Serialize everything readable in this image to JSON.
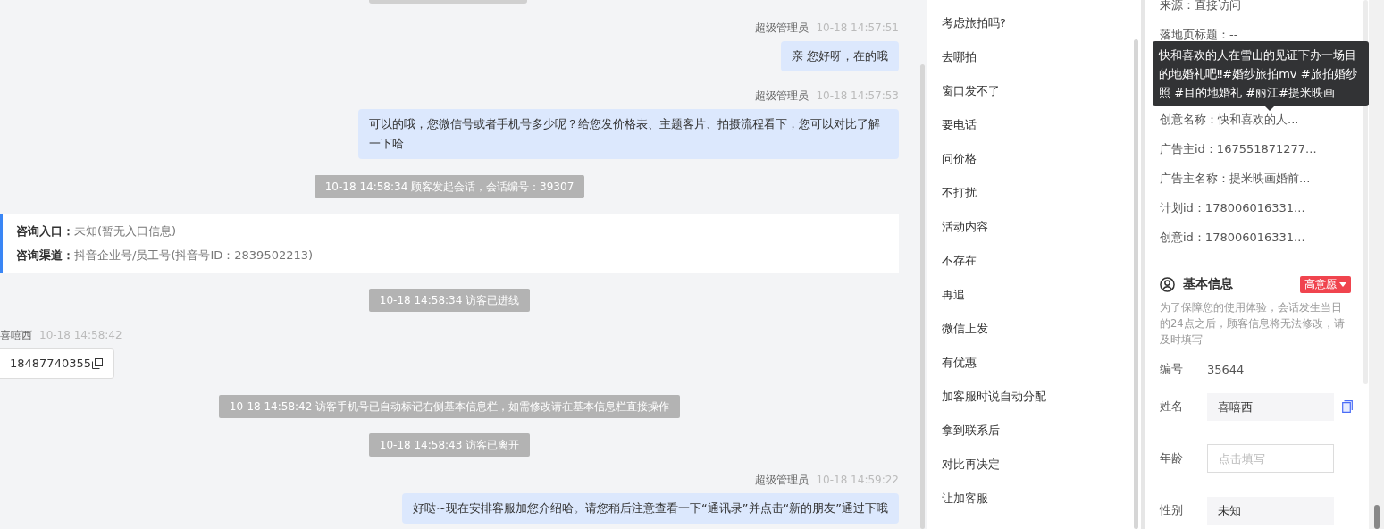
{
  "chat": {
    "messages": [
      {
        "kind": "agent",
        "sender": "超级管理员",
        "time": "10-18 14:57:51",
        "text": "亲 您好呀，在的哦"
      },
      {
        "kind": "agent",
        "sender": "超级管理员",
        "time": "10-18 14:57:53",
        "text": "可以的哦，您微信号或者手机号多少呢？给您发价格表、主题客片、拍摄流程看下，您可以对比了解一下哈"
      },
      {
        "kind": "system",
        "text": "10-18 14:58:34 顾客发起会话，会话编号：39307"
      },
      {
        "kind": "entry_card",
        "rows": [
          {
            "label": "咨询入口：",
            "value": "未知(暂无入口信息)"
          },
          {
            "label": "咨询渠道：",
            "value": "抖音企业号/员工号(抖音号ID：2839502213)"
          }
        ]
      },
      {
        "kind": "system",
        "text": "10-18 14:58:34 访客已进线"
      },
      {
        "kind": "visitor",
        "sender": "喜嘻西",
        "time": "10-18 14:58:42",
        "text": "18487740355"
      },
      {
        "kind": "system",
        "text": "10-18 14:58:42 访客手机号已自动标记右侧基本信息栏，如需修改请在基本信息栏直接操作"
      },
      {
        "kind": "system",
        "text": "10-18 14:58:43 访客已离开"
      },
      {
        "kind": "agent",
        "sender": "超级管理员",
        "time": "10-18 14:59:22",
        "text": "好哒~现在安排客服加您介绍哈。请您稍后注意查看一下“通讯录”并点击“新的朋友”通过下哦"
      }
    ]
  },
  "quick_replies": [
    "考虑旅拍吗?",
    "去哪拍",
    "窗口发不了",
    "要电话",
    "问价格",
    "不打扰",
    "活动内容",
    "不存在",
    "再追",
    "微信上发",
    "有优惠",
    "加客服时说自动分配",
    "拿到联系后",
    "对比再决定",
    "让加客服"
  ],
  "source_info": {
    "top_rows": [
      "来源：直接访问",
      "落地页标题：--"
    ],
    "rows": [
      "创意名称：快和喜欢的人...",
      "广告主id：167551871277...",
      "广告主名称：提米映画婚前...",
      "计划id：178006016331...",
      "创意id：178006016331..."
    ],
    "tooltip": "快和喜欢的人在雪山的见证下办一场目的地婚礼吧‼#婚纱旅拍mv #旅拍婚纱照 #目的地婚礼 #丽江#提米映画"
  },
  "basic_info": {
    "title": "基本信息",
    "intent_tag": "高意愿",
    "hint": "为了保障您的使用体验，会话发生当日的24点之后，顾客信息将无法修改，请及时填写",
    "fields": [
      {
        "label": "编号",
        "kind": "text",
        "value": "35644"
      },
      {
        "label": "姓名",
        "kind": "filled",
        "value": "喜嘻西"
      },
      {
        "label": "年龄",
        "kind": "input",
        "placeholder": "点击填写"
      },
      {
        "label": "性别",
        "kind": "filled",
        "value": "未知"
      }
    ]
  }
}
